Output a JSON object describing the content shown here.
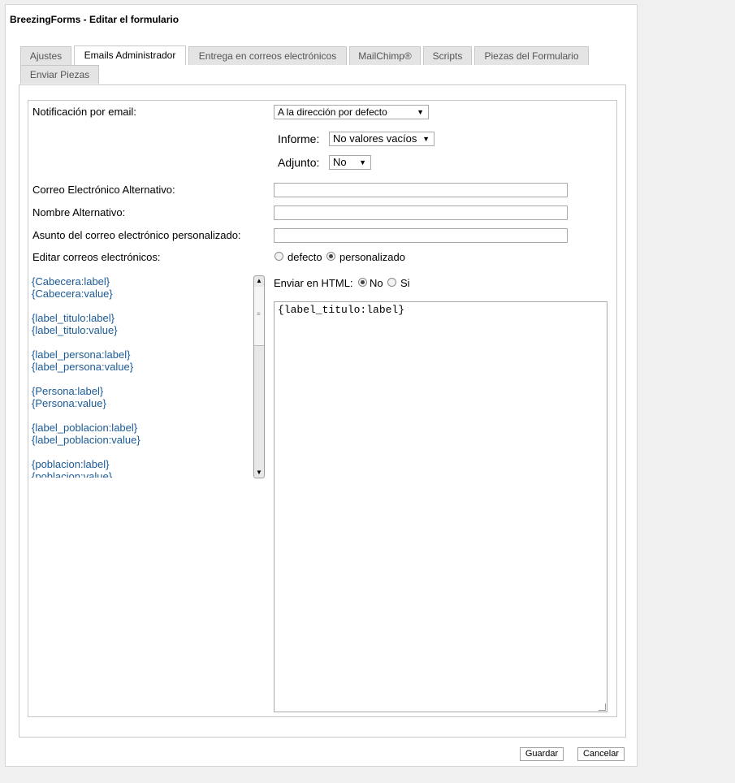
{
  "window": {
    "title": "BreezingForms - Editar el formulario"
  },
  "tabs": [
    {
      "label": "Ajustes"
    },
    {
      "label": "Emails Administrador"
    },
    {
      "label": "Entrega en correos electrónicos"
    },
    {
      "label": "MailChimp®"
    },
    {
      "label": "Scripts"
    },
    {
      "label": "Piezas del Formulario"
    },
    {
      "label": "Enviar Piezas"
    }
  ],
  "active_tab": "Emails Administrador",
  "form": {
    "notificacion_label": "Notificación por email:",
    "notificacion_value": "A la dirección por defecto",
    "informe_label": "Informe:",
    "informe_value": "No valores vacíos",
    "adjunto_label": "Adjunto:",
    "adjunto_value": "No",
    "correo_alt_label": "Correo Electrónico Alternativo:",
    "correo_alt_value": "",
    "nombre_alt_label": "Nombre Alternativo:",
    "nombre_alt_value": "",
    "asunto_label": "Asunto del correo electrónico personalizado:",
    "asunto_value": "",
    "editar_label": "Editar correos electrónicos:",
    "editar_opt_default": "defecto",
    "editar_opt_custom": "personalizado",
    "editar_selected": "personalizado",
    "html_label": "Enviar en HTML:",
    "html_opt_no": "No",
    "html_opt_si": "Si",
    "html_selected": "No"
  },
  "field_list": [
    "{Cabecera:label}",
    "{Cabecera:value}",
    "{label_titulo:label}",
    "{label_titulo:value}",
    "{label_persona:label}",
    "{label_persona:value}",
    "{Persona:label}",
    "{Persona:value}",
    "{label_poblacion:label}",
    "{label_poblacion:value}",
    "{poblacion:label}",
    "{poblacion:value}"
  ],
  "editor": {
    "content": "{label_titulo:label}"
  },
  "buttons": {
    "save": "Guardar",
    "cancel": "Cancelar"
  },
  "colors": {
    "link": "#1a5a96",
    "tab_bg": "#e4e4e4"
  }
}
